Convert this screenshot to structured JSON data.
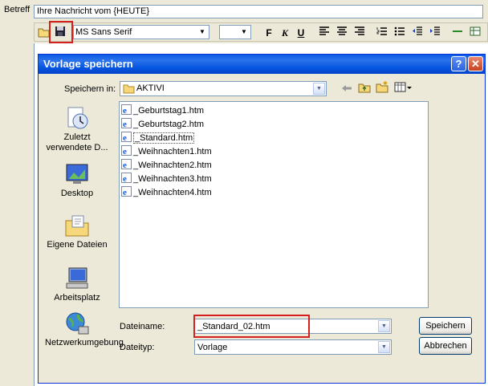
{
  "editor": {
    "betreff_label": "Betreff",
    "betreff_value": "Ihre Nachricht vom {HEUTE}",
    "font_name": "MS Sans Serif",
    "bold": "F",
    "italic": "K",
    "underline": "U"
  },
  "dialog": {
    "title": "Vorlage speichern",
    "help": "?",
    "close": "✕",
    "save_in_label": "Speichern in:",
    "current_folder": "AKTIVI",
    "places": [
      {
        "label": "Zuletzt verwendete D..."
      },
      {
        "label": "Desktop"
      },
      {
        "label": "Eigene Dateien"
      },
      {
        "label": "Arbeitsplatz"
      },
      {
        "label": "Netzwerkumgebung"
      }
    ],
    "files": [
      "_Geburtstag1.htm",
      "_Geburtstag2.htm",
      "_Standard.htm",
      "_Weihnachten1.htm",
      "_Weihnachten2.htm",
      "_Weihnachten3.htm",
      "_Weihnachten4.htm"
    ],
    "filename_label": "Dateiname:",
    "filename_value": "_Standard_02.htm",
    "filetype_label": "Dateityp:",
    "filetype_value": "Vorlage",
    "save_button": "Speichern",
    "cancel_button": "Abbrechen"
  },
  "colors": {
    "titlebar": "#0554e0",
    "highlight": "#d62020",
    "dialog_bg": "#ece9d8"
  }
}
